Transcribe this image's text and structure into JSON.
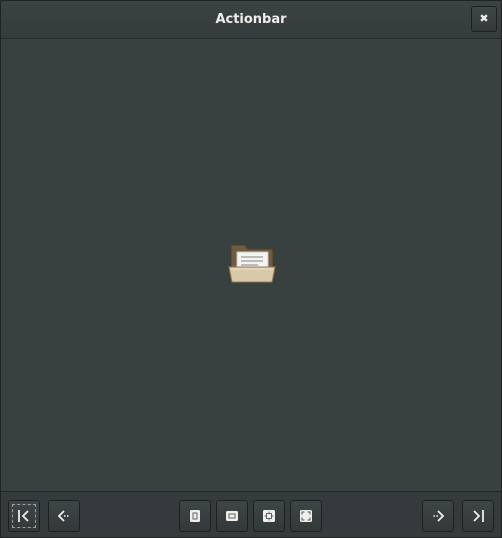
{
  "window": {
    "title": "Actionbar",
    "close_icon": "close-icon"
  },
  "content": {
    "icon": "open-folder-icon"
  },
  "actionbar": {
    "start": [
      {
        "name": "go-first-button",
        "icon": "go-first-icon"
      },
      {
        "name": "go-previous-button",
        "icon": "go-previous-icon"
      }
    ],
    "center": [
      {
        "name": "view-portrait-button",
        "icon": "portrait-icon"
      },
      {
        "name": "view-landscape-button",
        "icon": "landscape-icon"
      },
      {
        "name": "zoom-fit-button",
        "icon": "zoom-fit-icon"
      },
      {
        "name": "fullscreen-button",
        "icon": "fullscreen-icon"
      }
    ],
    "end": [
      {
        "name": "go-next-button",
        "icon": "go-next-icon"
      },
      {
        "name": "go-last-button",
        "icon": "go-last-icon"
      }
    ]
  },
  "colors": {
    "background": "#394040",
    "titlebar": "#393f40",
    "text": "#eeeeec",
    "folder": "#8a7352"
  }
}
